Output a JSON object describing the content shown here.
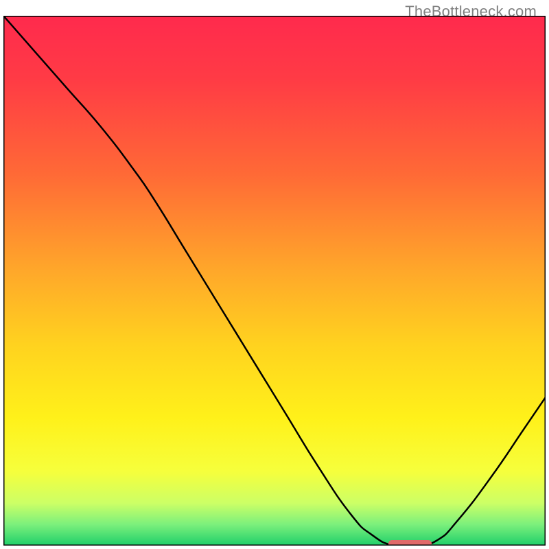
{
  "watermark": "TheBottleneck.com",
  "chart_data": {
    "type": "line",
    "title": "",
    "xlabel": "",
    "ylabel": "",
    "xlim": [
      0,
      100
    ],
    "ylim": [
      0,
      100
    ],
    "x": [
      0,
      6,
      12,
      18,
      24,
      28,
      34,
      40,
      46,
      52,
      58,
      64,
      68,
      72,
      76,
      80,
      84,
      90,
      96,
      100
    ],
    "values": [
      100,
      93,
      86,
      79,
      71,
      65,
      55,
      45,
      35,
      25,
      15,
      6,
      2,
      0,
      0,
      1,
      5,
      13,
      22,
      28
    ],
    "marker": {
      "x_start": 71,
      "x_end": 79,
      "y": 0
    },
    "gradient_stops": [
      {
        "offset": 0.0,
        "color": "#ff2a4d"
      },
      {
        "offset": 0.12,
        "color": "#ff3b45"
      },
      {
        "offset": 0.3,
        "color": "#ff6a36"
      },
      {
        "offset": 0.48,
        "color": "#ffa72a"
      },
      {
        "offset": 0.62,
        "color": "#ffd21f"
      },
      {
        "offset": 0.76,
        "color": "#fff11a"
      },
      {
        "offset": 0.86,
        "color": "#f6ff3c"
      },
      {
        "offset": 0.92,
        "color": "#ccff66"
      },
      {
        "offset": 0.96,
        "color": "#7cf07c"
      },
      {
        "offset": 1.0,
        "color": "#1ecf6a"
      }
    ],
    "marker_color": "#e06a6a",
    "curve_color": "#000000",
    "border_color": "#000000"
  }
}
